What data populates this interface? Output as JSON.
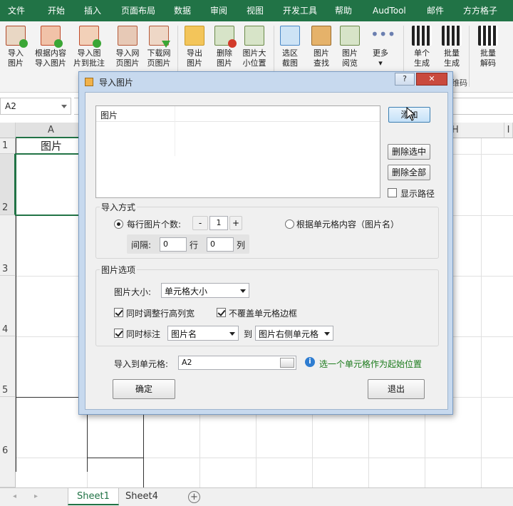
{
  "menu": [
    "文件",
    "开始",
    "插入",
    "页面布局",
    "数据",
    "审阅",
    "视图",
    "开发工具",
    "帮助",
    "AudTool",
    "邮件",
    "方方格子"
  ],
  "ribbon": {
    "buttons": [
      {
        "line1": "导入",
        "line2": "图片"
      },
      {
        "line1": "根据内容",
        "line2": "导入图片"
      },
      {
        "line1": "导入图",
        "line2": "片到批注"
      },
      {
        "line1": "导入网",
        "line2": "页图片"
      },
      {
        "line1": "下载网",
        "line2": "页图片"
      },
      {
        "line1": "导出",
        "line2": "图片"
      },
      {
        "line1": "删除",
        "line2": "图片"
      },
      {
        "line1": "图片大",
        "line2": "小位置"
      },
      {
        "line1": "选区",
        "line2": "截图"
      },
      {
        "line1": "图片",
        "line2": "查找"
      },
      {
        "line1": "图片",
        "line2": "阅览"
      },
      {
        "line1": "更多",
        "line2": "▾"
      },
      {
        "line1": "单个",
        "line2": "生成"
      },
      {
        "line1": "批量",
        "line2": "生成"
      },
      {
        "line1": "批量",
        "line2": "解码"
      }
    ],
    "group_label_fragment": "维码"
  },
  "formula_bar": {
    "name_box": "A2"
  },
  "grid": {
    "columns": [
      "A",
      "H",
      "I"
    ],
    "rows": [
      "1",
      "2",
      "3",
      "4",
      "5",
      "6"
    ],
    "cell_a1": "图片"
  },
  "sheets": {
    "tabs": [
      "Sheet1",
      "Sheet4"
    ],
    "active": "Sheet1",
    "add": "+"
  },
  "dialog": {
    "title": "导入图片",
    "help": "?",
    "close": "✕",
    "list_header": "图片",
    "buttons": {
      "add": "添加",
      "delete_selected": "删除选中",
      "delete_all": "删除全部",
      "ok": "确定",
      "cancel": "退出"
    },
    "show_path": "显示路径",
    "import_mode": {
      "label": "导入方式",
      "per_row_label": "每行图片个数:",
      "minus": "-",
      "per_row_value": "1",
      "plus": "+",
      "by_content": "根据单元格内容（图片名）",
      "spacing_label": "间隔:",
      "row_gap": "0",
      "row_unit": "行",
      "col_gap": "0",
      "col_unit": "列"
    },
    "options": {
      "label": "图片选项",
      "size_label": "图片大小:",
      "size_value": "单元格大小",
      "adjust_row_col": "同时调整行高列宽",
      "no_cover_border": "不覆盖单元格边框",
      "annotate": "同时标注",
      "annotate_value": "图片名",
      "to": "到",
      "target_value": "图片右侧单元格"
    },
    "import_to": {
      "label": "导入到单元格:",
      "value": "A2",
      "hint": "选一个单元格作为起始位置"
    }
  },
  "colors": {
    "excel_green": "#217346",
    "hint_green": "#1a7a1a",
    "info_blue": "#2f7dd1"
  }
}
